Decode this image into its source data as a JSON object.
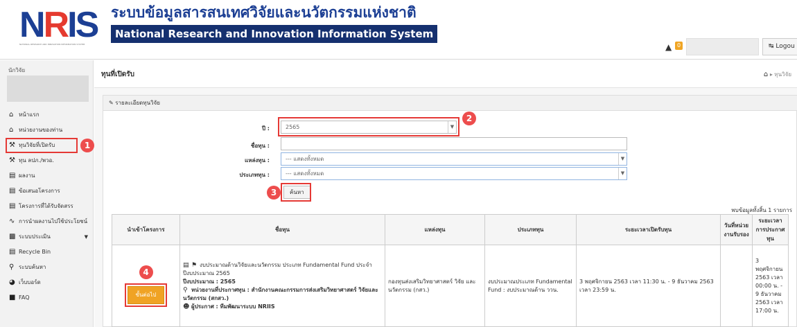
{
  "header": {
    "logo_text": "NRIS",
    "logo_subtext": "NATIONAL RESEARCH AND INNOVATION INFORMATION SYSTEM",
    "title_th": "ระบบข้อมูลสารสนเทศวิจัยและนวัตกรรมแห่งชาติ",
    "title_en": "National Research and Innovation Information System",
    "notification_count": "0",
    "logout_label": "Logou"
  },
  "sidebar": {
    "user_label": "นักวิจัย",
    "items": [
      {
        "label": "หน้าแรก",
        "icon": "home-icon"
      },
      {
        "label": "หน่วยงานของท่าน",
        "icon": "home-icon"
      },
      {
        "label": "ทุนวิจัยที่เปิดรับ",
        "icon": "gavel-icon"
      },
      {
        "label": "ทุน ลปภ./พวอ.",
        "icon": "gavel-icon"
      },
      {
        "label": "ผลงาน",
        "icon": "file-icon"
      },
      {
        "label": "ข้อเสนอโครงการ",
        "icon": "file-icon"
      },
      {
        "label": "โครงการที่ได้รับจัดสรร",
        "icon": "file-icon"
      },
      {
        "label": "การนำผลงานไปใช้ประโยชน์",
        "icon": "chart-line-icon"
      },
      {
        "label": "ระบบประเมิน",
        "icon": "chart-bar-icon"
      },
      {
        "label": "Recycle Bin",
        "icon": "recycle-icon"
      },
      {
        "label": "ระบบค้นหา",
        "icon": "search-icon"
      },
      {
        "label": "เว็บบอร์ด",
        "icon": "globe-icon"
      },
      {
        "label": "FAQ",
        "icon": "faq-icon"
      }
    ]
  },
  "page": {
    "title": "ทุนที่เปิดรับ",
    "breadcrumb": "ทุนวิจัย"
  },
  "panel": {
    "title": "รายละเอียดทุนวิจัย"
  },
  "form": {
    "year_label": "ปี :",
    "year_value": "2565",
    "fund_name_label": "ชื่อทุน :",
    "fund_name_value": "",
    "source_label": "แหล่งทุน :",
    "source_value": "--- แสดงทั้งหมด",
    "type_label": "ประเภททุน :",
    "type_value": "--- แสดงทั้งหมด",
    "search_button": "ค้นหา"
  },
  "markers": [
    "1",
    "2",
    "3",
    "4"
  ],
  "results": {
    "total_text": "พบข้อมูลทั้งสิ้น 1 รายการ",
    "columns": [
      "นำเข้าโครงการ",
      "ชื่อทุน",
      "แหล่งทุน",
      "ประเภททุน",
      "ระยะเวลาเปิดรับทุน",
      "วันที่หน่วยงานรับรอง",
      "ระยะเวลาการประกาศทุน"
    ],
    "rows": [
      {
        "import_button": "ขั้นต่อไป",
        "fund_title": "งบประมาณด้านวิจัยและนวัตกรรม ประเภท Fundamental Fund ประจำปีงบประมาณ 2565",
        "fiscal_year": "ปีงบประมาณ : 2565",
        "announcer_agency": "หน่วยงานที่ประกาศทุน : สำนักงานคณะกรรมการส่งเสริมวิทยาศาสตร์ วิจัยและนวัตกรรม (สกสว.)",
        "announcer": "ผู้ประกาศ : ทีมพัฒนาระบบ NRIIS",
        "source": "กองทุนส่งเสริมวิทยาศาสตร์ วิจัย และนวัตกรรม (กสว.)",
        "type": "งบประมาณประเภท Fundamental Fund : งบประมาณด้าน ววน.",
        "open_period": "3 พฤศจิกายน 2563 เวลา 11:30 น. - 9 ธันวาคม 2563 เวลา 23:59 น.",
        "certified_date": "",
        "announce_period": "3 พฤศจิกายน 2563 เวลา 00:00 น. - 9 ธันวาคม 2563 เวลา 17:00 น."
      }
    ]
  },
  "colors": {
    "brand_blue": "#1c3f94",
    "brand_red": "#e53a2f",
    "marker_red": "#ed4d4d",
    "import_orange": "#f0a324"
  }
}
